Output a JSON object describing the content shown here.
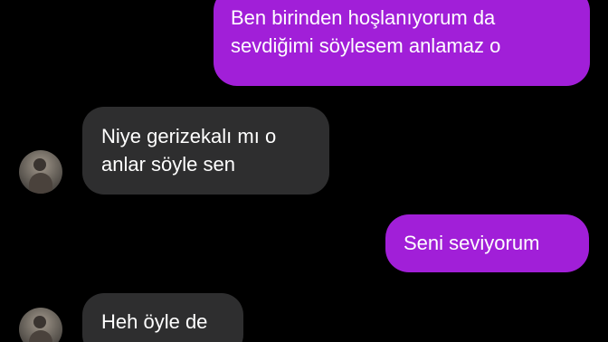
{
  "conversation": {
    "messages": [
      {
        "sender": "self",
        "lines": [
          "Ben birinden hoşlanıyorum da",
          "sevdiğimi söylesem anlamaz o"
        ]
      },
      {
        "sender": "other",
        "lines": [
          "Niye gerizekalı mı o",
          "anlar söyle sen"
        ]
      },
      {
        "sender": "self",
        "lines": [
          "Seni seviyorum"
        ]
      },
      {
        "sender": "other",
        "lines": [
          "Heh öyle de"
        ]
      }
    ]
  },
  "colors": {
    "background": "#000000",
    "sent_bubble": "#a11fd8",
    "received_bubble": "#2e2e2f",
    "text": "#ffffff"
  },
  "icons": {
    "avatar": "contact-avatar"
  }
}
